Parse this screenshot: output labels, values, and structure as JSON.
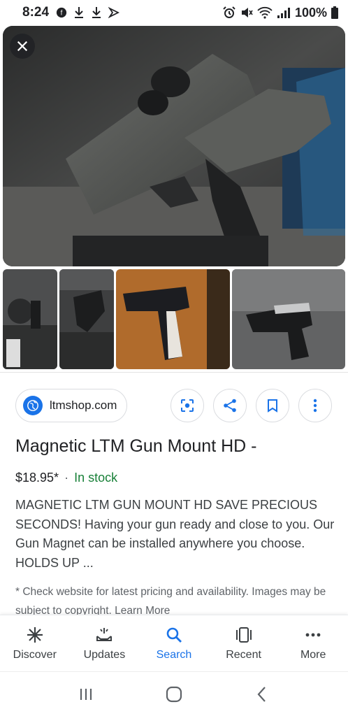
{
  "status_bar": {
    "time": "8:24",
    "battery": "100%",
    "icons": [
      "notification-icon",
      "download-icon",
      "download-icon",
      "cast-icon",
      "alarm-icon",
      "mute-icon",
      "wifi-icon",
      "signal-icon",
      "battery-icon"
    ]
  },
  "hero": {
    "close_icon": "close-icon"
  },
  "result": {
    "source": "ltmshop.com",
    "title": "Magnetic LTM Gun Mount HD -",
    "price": "$18.95*",
    "separator": "·",
    "stock": "In stock",
    "description": "MAGNETIC LTM GUN MOUNT HD SAVE PRECIOUS SECONDS! Having your gun ready and close to you. Our Gun Magnet can be installed anywhere you choose. HOLDS UP ...",
    "note": "* Check website for latest pricing and availability. Images may be subject to copyright. Learn More"
  },
  "actions": [
    "lens-icon",
    "share-icon",
    "bookmark-icon",
    "more-vert-icon"
  ],
  "bottom_nav": {
    "items": [
      {
        "label": "Discover",
        "icon": "asterisk-icon"
      },
      {
        "label": "Updates",
        "icon": "updates-icon"
      },
      {
        "label": "Search",
        "icon": "search-icon"
      },
      {
        "label": "Recent",
        "icon": "recent-icon"
      },
      {
        "label": "More",
        "icon": "more-horiz-icon"
      }
    ],
    "active": "Search"
  },
  "system_nav": [
    "recents-icon",
    "home-icon",
    "back-icon"
  ],
  "colors": {
    "accent": "#1a73e8",
    "stock": "#188038",
    "text": "#202124"
  }
}
